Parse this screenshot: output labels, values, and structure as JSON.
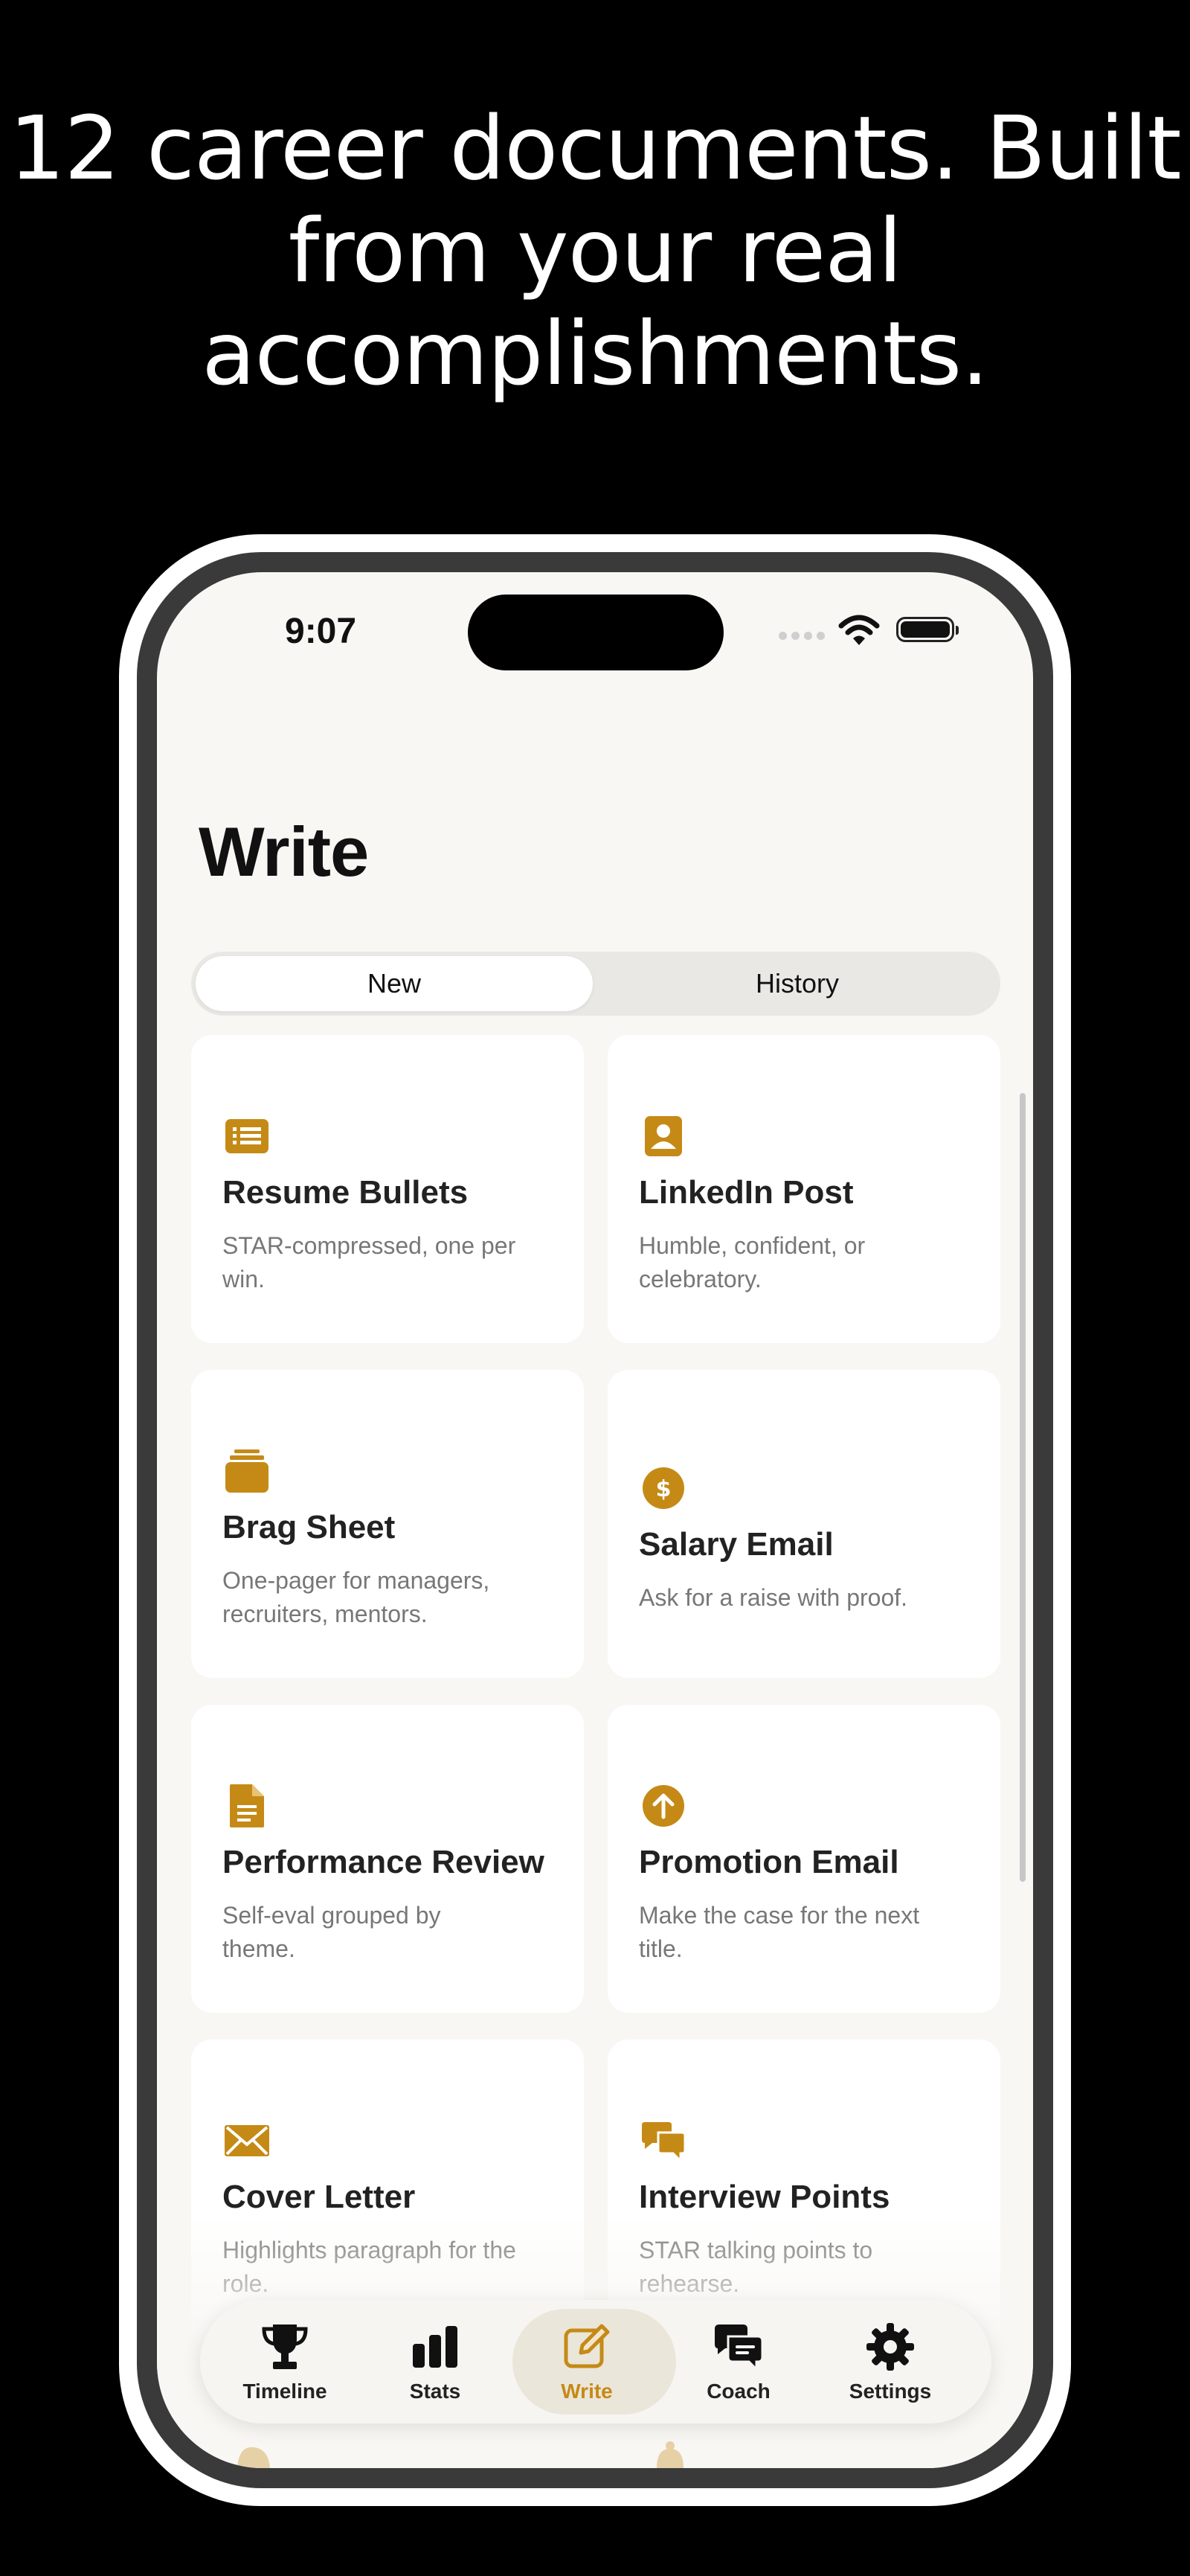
{
  "headline": {
    "line1": "12 career documents. Built",
    "line2": "from your real",
    "line3": "accomplishments."
  },
  "status_bar": {
    "time": "9:07"
  },
  "page": {
    "title": "Write"
  },
  "segments": {
    "new_label": "New",
    "history_label": "History",
    "selected": "New"
  },
  "cards": [
    {
      "icon": "resume-list-icon",
      "title": "Resume Bullets",
      "desc": "STAR-compressed, one per win."
    },
    {
      "icon": "person-badge-icon",
      "title": "LinkedIn Post",
      "desc": "Humble, confident, or celebratory."
    },
    {
      "icon": "stacked-tray-icon",
      "title": "Brag Sheet",
      "desc": "One-pager for managers, recruiters, mentors."
    },
    {
      "icon": "dollar-circle-icon",
      "title": "Salary Email",
      "desc": "Ask for a raise with proof."
    },
    {
      "icon": "document-icon",
      "title": "Performance Review",
      "desc": "Self-eval grouped by theme."
    },
    {
      "icon": "arrow-up-circle-icon",
      "title": "Promotion Email",
      "desc": "Make the case for the next title."
    },
    {
      "icon": "envelope-icon",
      "title": "Cover Letter",
      "desc": "Highlights paragraph for the role."
    },
    {
      "icon": "speech-bubbles-icon",
      "title": "Interview Points",
      "desc": "STAR talking points to rehearse."
    }
  ],
  "tabs": [
    {
      "label": "Timeline",
      "icon": "trophy-icon"
    },
    {
      "label": "Stats",
      "icon": "bar-chart-icon"
    },
    {
      "label": "Write",
      "icon": "compose-icon",
      "active": true
    },
    {
      "label": "Coach",
      "icon": "chat-bubbles-icon"
    },
    {
      "label": "Settings",
      "icon": "gear-icon"
    }
  ],
  "colors": {
    "accent": "#C58A16",
    "background": "#F8F7F4",
    "card": "#FFFFFF"
  }
}
